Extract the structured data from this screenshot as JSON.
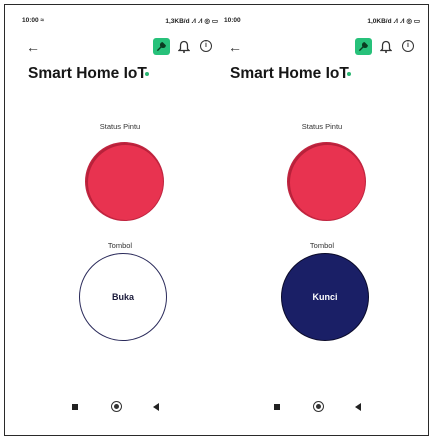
{
  "phones": [
    {
      "status_bar": {
        "time": "10:00 ≈",
        "right": "1,3KB/d .∕l .∕l ◎ ▭"
      },
      "app_title": "Smart Home IoT",
      "status_label": "Status Pintu",
      "status_color": "#e83350",
      "tombol_label": "Tombol",
      "toggle_label": "Buka"
    },
    {
      "status_bar": {
        "time": "10:00",
        "right": "1,0KB/d .∕l .∕l ◎ ▭"
      },
      "app_title": "Smart Home IoT",
      "status_label": "Status Pintu",
      "status_color": "#e83350",
      "tombol_label": "Tombol",
      "toggle_label": "Kunci"
    }
  ],
  "icons": {
    "back": "arrow-left-icon",
    "wrench": "wrench-icon",
    "bell": "bell-icon",
    "info": "info-icon",
    "nav_recents": "square-icon",
    "nav_home": "circle-icon",
    "nav_back": "triangle-back-icon"
  },
  "colors": {
    "accent_green": "#27c17a",
    "status_red": "#e83350",
    "lock_navy": "#1a1f66"
  }
}
